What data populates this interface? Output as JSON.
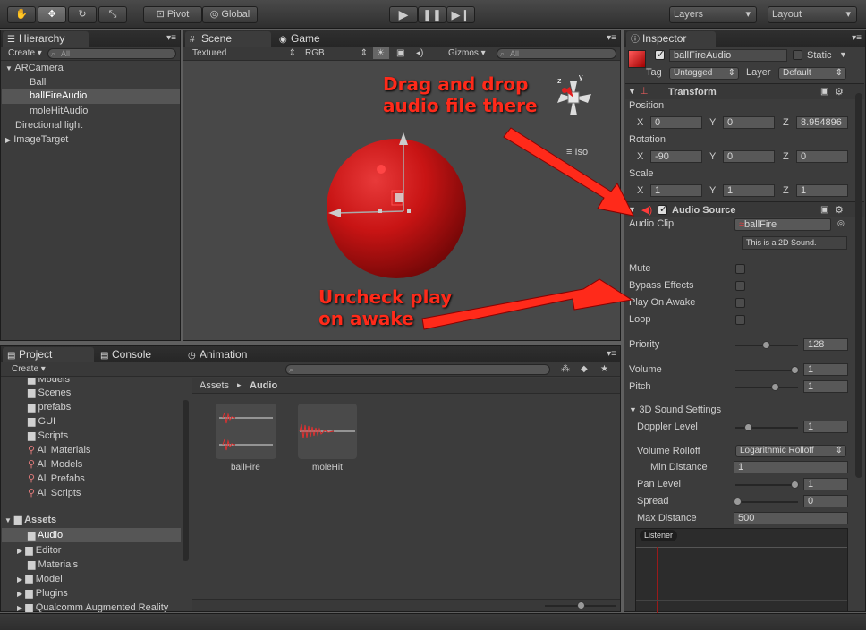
{
  "toolbar": {
    "pivot": "Pivot",
    "global": "Global",
    "layers": "Layers",
    "layout": "Layout"
  },
  "hierarchy": {
    "tab": "Hierarchy",
    "create": "Create",
    "search_placeholder": "All",
    "items": [
      "ARCamera",
      "Ball",
      "ballFireAudio",
      "moleHitAudio",
      "Directional light",
      "ImageTarget"
    ]
  },
  "scene": {
    "tab_scene": "Scene",
    "tab_game": "Game",
    "textured": "Textured",
    "rgb": "RGB",
    "gizmos": "Gizmos",
    "search_placeholder": "All",
    "iso": "Iso",
    "axis_y": "y",
    "axis_z": "z"
  },
  "project": {
    "tab_project": "Project",
    "tab_console": "Console",
    "tab_animation": "Animation",
    "create": "Create",
    "tree": [
      "Models",
      "Scenes",
      "prefabs",
      "GUI",
      "Scripts",
      "All Materials",
      "All Models",
      "All Prefabs",
      "All Scripts",
      "Assets",
      "Audio",
      "Editor",
      "Materials",
      "Model",
      "Plugins",
      "Qualcomm Augmented Reality"
    ],
    "breadcrumb_root": "Assets",
    "breadcrumb_sep": "▸",
    "breadcrumb_current": "Audio",
    "assets": [
      "ballFire",
      "moleHit"
    ]
  },
  "inspector": {
    "tab": "Inspector",
    "object_name": "ballFireAudio",
    "static": "Static",
    "tag_label": "Tag",
    "tag_value": "Untagged",
    "layer_label": "Layer",
    "layer_value": "Default",
    "transform": {
      "title": "Transform",
      "position": "Position",
      "rotation": "Rotation",
      "scale": "Scale",
      "x": "X",
      "y": "Y",
      "z": "Z",
      "pos": [
        "0",
        "0",
        "8.954896"
      ],
      "rot": [
        "-90",
        "0",
        "0"
      ],
      "scl": [
        "1",
        "1",
        "1"
      ]
    },
    "audio": {
      "title": "Audio Source",
      "clip_label": "Audio Clip",
      "clip_value": "ballFire",
      "clip_note": "This is a 2D Sound.",
      "mute": "Mute",
      "bypass": "Bypass Effects",
      "play_on_awake": "Play On Awake",
      "loop": "Loop",
      "priority": "Priority",
      "priority_value": "128",
      "volume": "Volume",
      "volume_value": "1",
      "pitch": "Pitch",
      "pitch_value": "1",
      "sound3d": "3D Sound Settings",
      "doppler": "Doppler Level",
      "doppler_value": "1",
      "rolloff": "Volume Rolloff",
      "rolloff_value": "Logarithmic Rolloff",
      "min_dist": "Min Distance",
      "min_dist_value": "1",
      "pan": "Pan Level",
      "pan_value": "1",
      "spread": "Spread",
      "spread_value": "0",
      "max_dist": "Max Distance",
      "max_dist_value": "500",
      "listener": "Listener"
    }
  },
  "annotations": {
    "drag": "Drag and drop\naudio file there",
    "uncheck": "Uncheck play\non awake",
    "color": "#ff2a1a"
  },
  "colors": {
    "panel": "#3c3c3c",
    "selection": "#565656",
    "ball": "#c81414"
  }
}
